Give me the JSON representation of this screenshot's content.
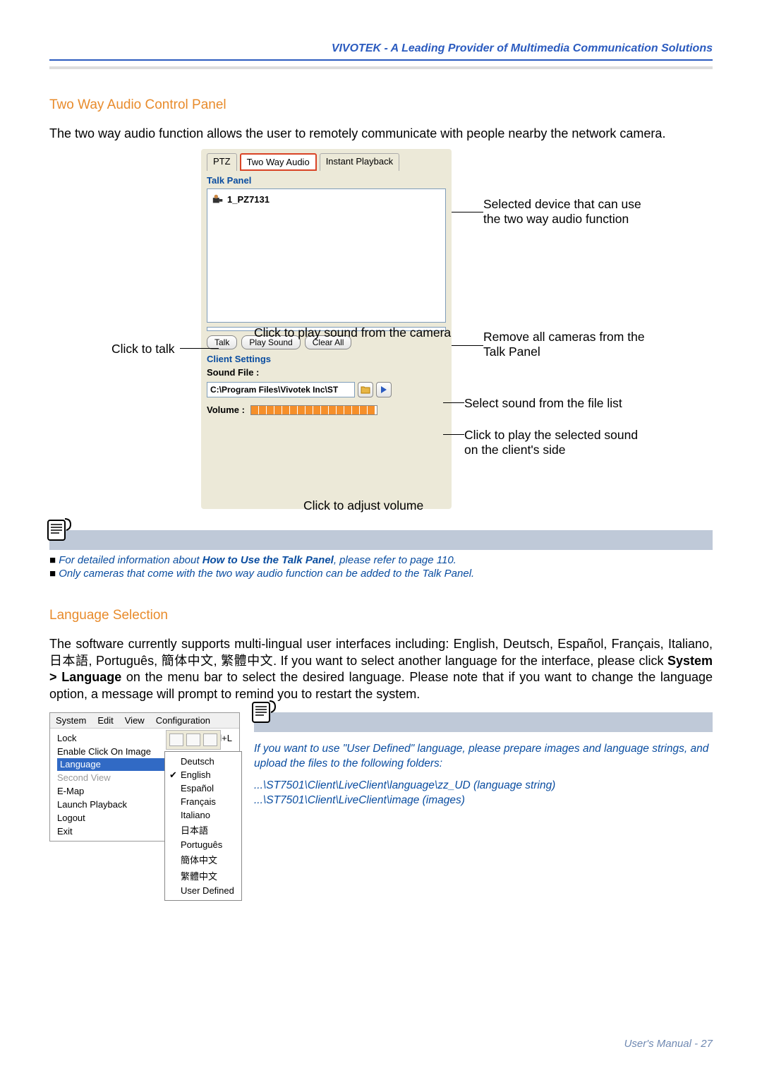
{
  "header": {
    "title": "VIVOTEK - A Leading Provider of Multimedia Communication Solutions"
  },
  "section1": {
    "title": "Two Way Audio Control Panel",
    "intro": "The two way audio function allows the user to remotely communicate with people nearby the network camera."
  },
  "panel": {
    "tabs": {
      "ptz": "PTZ",
      "twoway": "Two Way Audio",
      "instant": "Instant Playback"
    },
    "talk_label": "Talk Panel",
    "device": "1_PZ7131",
    "btn_talk": "Talk",
    "btn_play": "Play Sound",
    "btn_clear": "Clear All",
    "client_label": "Client Settings",
    "sound_label": "Sound File :",
    "sound_path": "C:\\Program Files\\Vivotek Inc\\ST",
    "volume_label": "Volume :"
  },
  "callouts": {
    "talk": "Click to talk",
    "play_sound": "Click to play sound from the camera",
    "selected_dev": "Selected device that can use the two way audio function",
    "remove": "Remove all cameras from the Talk Panel",
    "select_sound": "Select sound from the file list",
    "play_selected": "Click to play the selected sound on the client's side",
    "adjust_vol": "Click to adjust volume"
  },
  "notes": {
    "n1_pre": "For detailed information about ",
    "n1_bold": "How to Use the Talk Panel",
    "n1_post": ", please refer to page 110.",
    "n2": "Only cameras that come with the two way audio function can be added to the Talk Panel."
  },
  "section2": {
    "title": "Language Selection",
    "body_pre": "The software currently supports multi-lingual user interfaces including: English, Deutsch, Español, Français, Italiano, 日本語, Português, 簡体中文, 繁體中文. If you want to select another language for the interface, please click ",
    "body_bold": "System > Language",
    "body_post": " on the menu bar to select the desired language. Please note that if you want to change the language option, a message will prompt to remind you to restart the system."
  },
  "menu": {
    "bar": {
      "system": "System",
      "edit": "Edit",
      "view": "View",
      "config": "Configuration"
    },
    "items": {
      "lock": "Lock",
      "lock_sc": "Ctrl+L",
      "enable": "Enable Click On Image",
      "language": "Language",
      "second": "Second View",
      "emap": "E-Map",
      "launch": "Launch Playback",
      "logout": "Logout",
      "exit": "Exit"
    },
    "langs": [
      "Deutsch",
      "English",
      "Español",
      "Français",
      "Italiano",
      "日本語",
      "Português",
      "簡体中文",
      "繁體中文",
      "User Defined"
    ]
  },
  "lang_note": {
    "p1": "If you want to use \"User Defined\" language, please prepare images and language strings, and upload the files to the following folders:",
    "p2": "...\\ST7501\\Client\\LiveClient\\language\\zz_UD (language string)",
    "p3": "...\\ST7501\\Client\\LiveClient\\image (images)"
  },
  "footer": "User's Manual - 27"
}
